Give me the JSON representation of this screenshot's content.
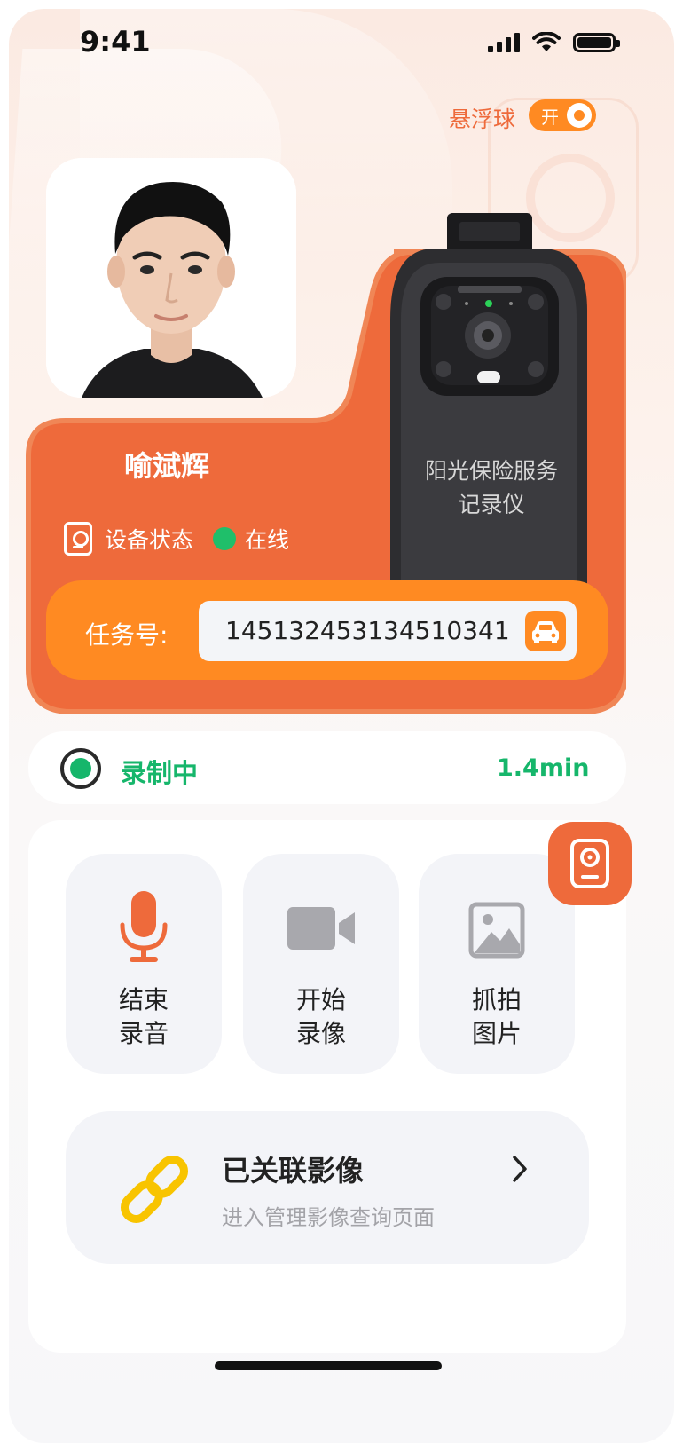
{
  "status_bar": {
    "time": "9:41"
  },
  "float_ball": {
    "label": "悬浮球",
    "toggle_text": "开",
    "state": "on"
  },
  "profile": {
    "name": "喻斌辉"
  },
  "device": {
    "status_label": "设备状态",
    "online_text": "在线",
    "camera_text_line1": "阳光保险服务",
    "camera_text_line2": "记录仪"
  },
  "task": {
    "label": "任务号:",
    "value": "14513245313451034​1"
  },
  "recording": {
    "status": "录制中",
    "duration": "1.4min"
  },
  "actions": [
    {
      "line1": "结束",
      "line2": "录音",
      "icon": "microphone-icon",
      "active": true
    },
    {
      "line1": "开始",
      "line2": "录像",
      "icon": "video-camera-icon",
      "active": false
    },
    {
      "line1": "抓拍",
      "line2": "图片",
      "icon": "image-icon",
      "active": false
    }
  ],
  "linked_media": {
    "title": "已关联影像",
    "subtitle": "进入管理影像查询页面"
  },
  "colors": {
    "orange": "#ee6a3b",
    "amber": "#ff8a22",
    "green": "#16b66b",
    "link_yellow": "#f8c400"
  }
}
